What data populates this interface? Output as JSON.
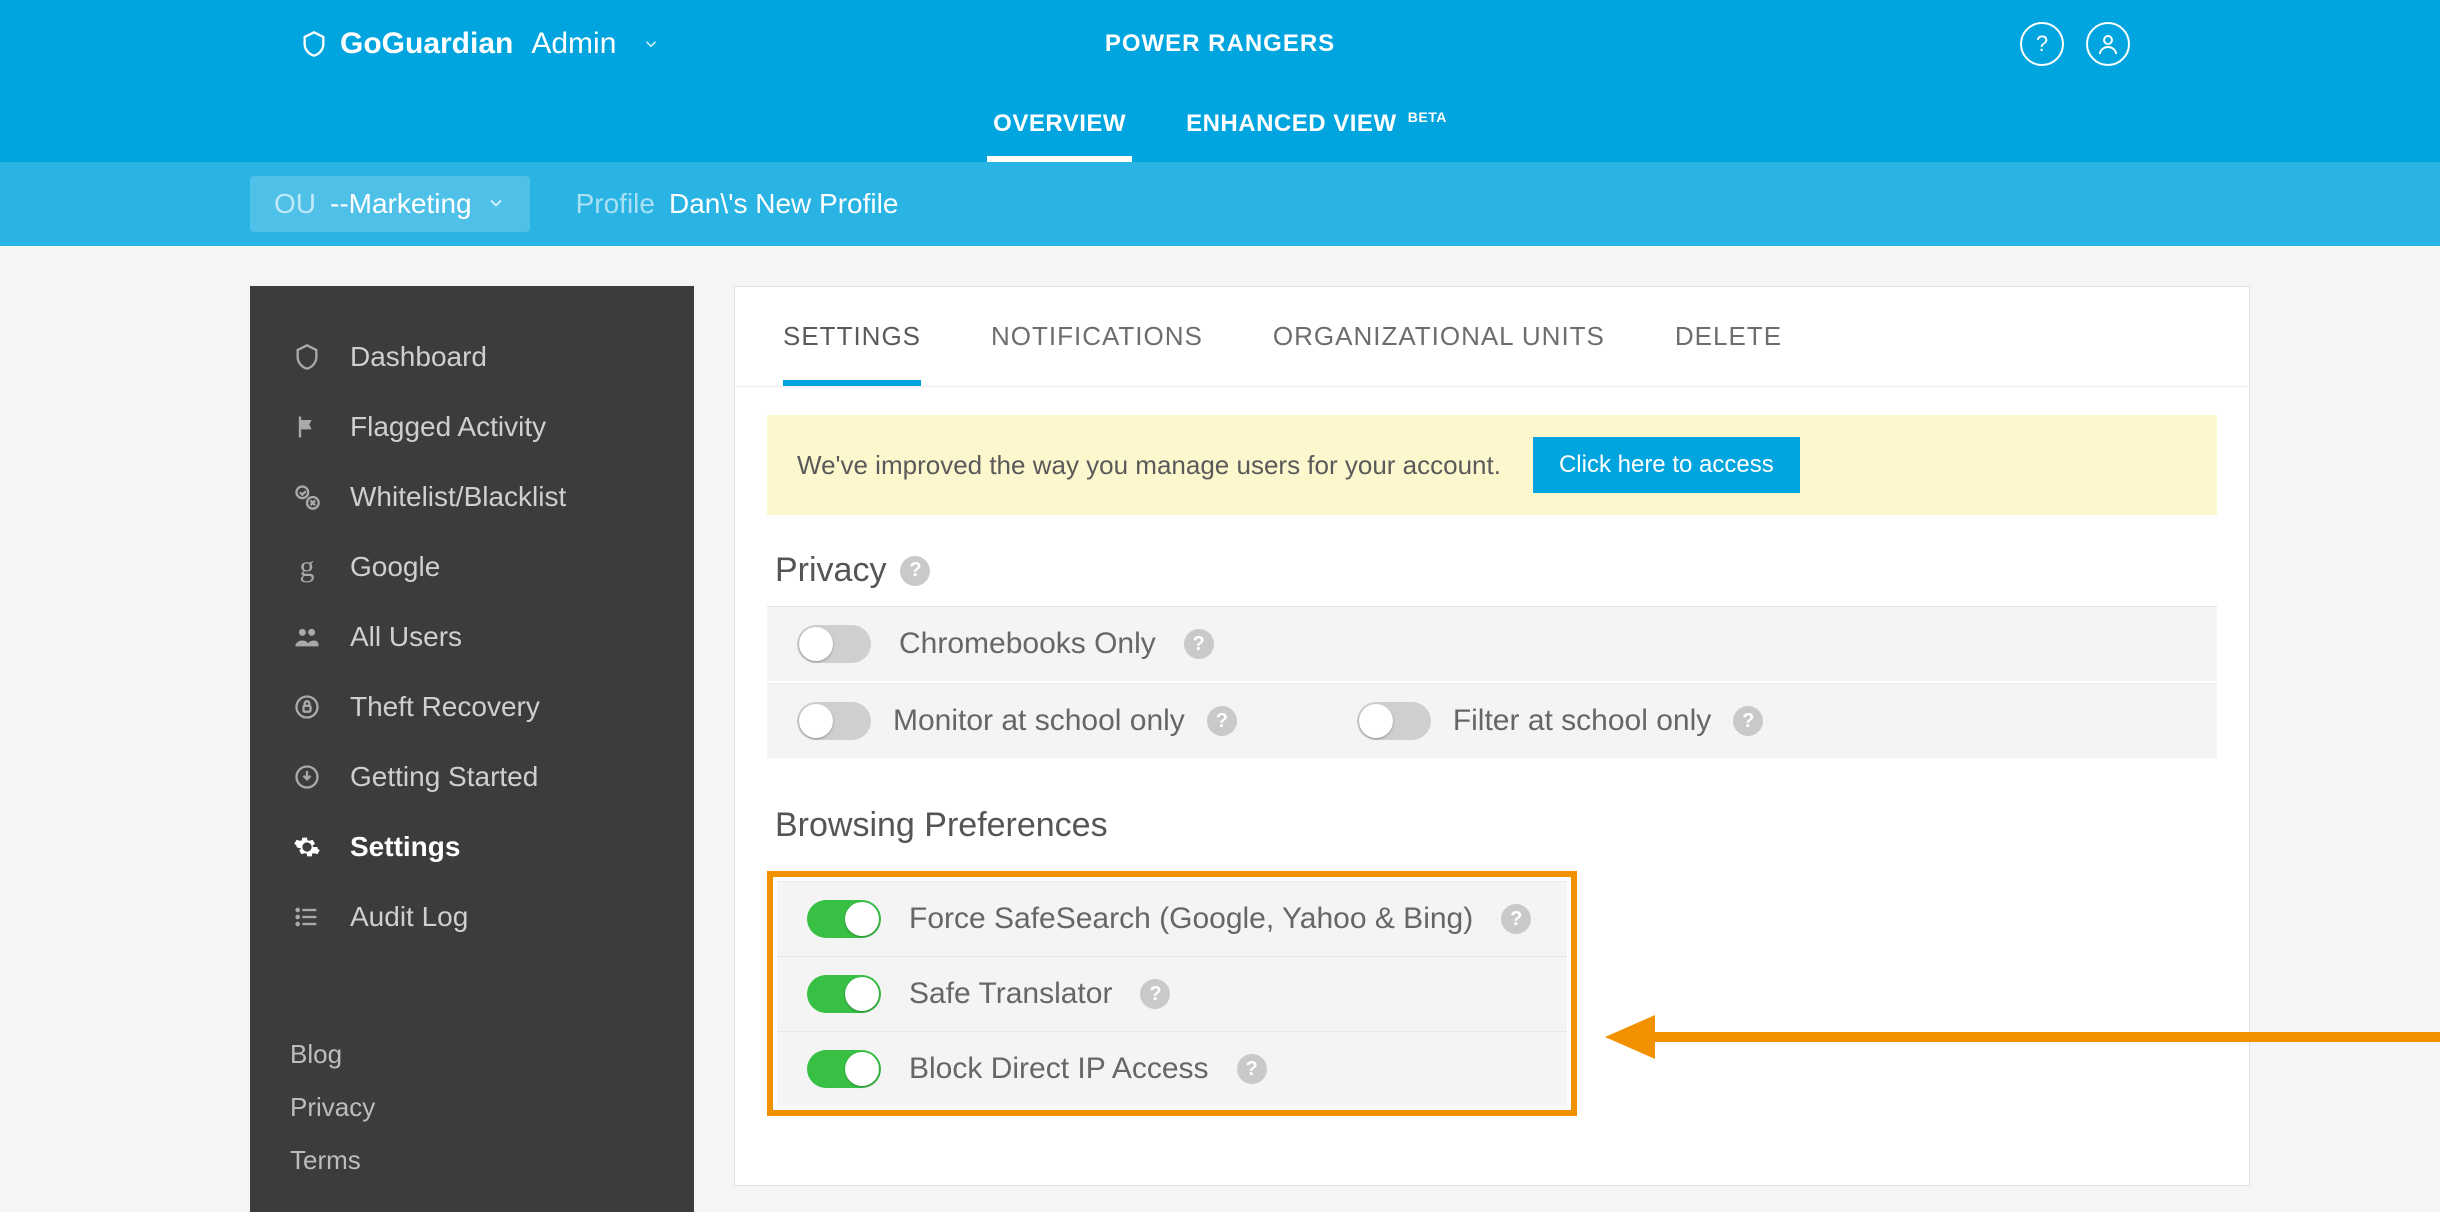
{
  "header": {
    "brand_name": "GoGuardian",
    "product": "Admin",
    "org": "POWER RANGERS"
  },
  "view_tabs": {
    "overview": "OVERVIEW",
    "enhanced": "ENHANCED VIEW",
    "beta_badge": "BETA"
  },
  "ou_bar": {
    "ou_label": "OU",
    "ou_value": "--Marketing",
    "profile_label": "Profile",
    "profile_value": "Dan\\'s New Profile"
  },
  "sidebar": {
    "items": [
      {
        "label": "Dashboard"
      },
      {
        "label": "Flagged Activity"
      },
      {
        "label": "Whitelist/Blacklist"
      },
      {
        "label": "Google"
      },
      {
        "label": "All Users"
      },
      {
        "label": "Theft Recovery"
      },
      {
        "label": "Getting Started"
      },
      {
        "label": "Settings"
      },
      {
        "label": "Audit Log"
      }
    ],
    "footer": [
      "Blog",
      "Privacy",
      "Terms"
    ]
  },
  "card_tabs": {
    "settings": "SETTINGS",
    "notifications": "NOTIFICATIONS",
    "org_units": "ORGANIZATIONAL UNITS",
    "delete": "DELETE"
  },
  "banner": {
    "text": "We've improved the way you manage users for your account.",
    "cta": "Click here to access"
  },
  "sections": {
    "privacy_title": "Privacy",
    "privacy_rows": {
      "chromebooks_only": "Chromebooks Only",
      "monitor_school_only": "Monitor at school only",
      "filter_school_only": "Filter at school only"
    },
    "browsing_title": "Browsing Preferences",
    "browsing_rows": {
      "force_safesearch": "Force SafeSearch (Google, Yahoo & Bing)",
      "safe_translator": "Safe Translator",
      "block_direct_ip": "Block Direct IP Access"
    }
  }
}
